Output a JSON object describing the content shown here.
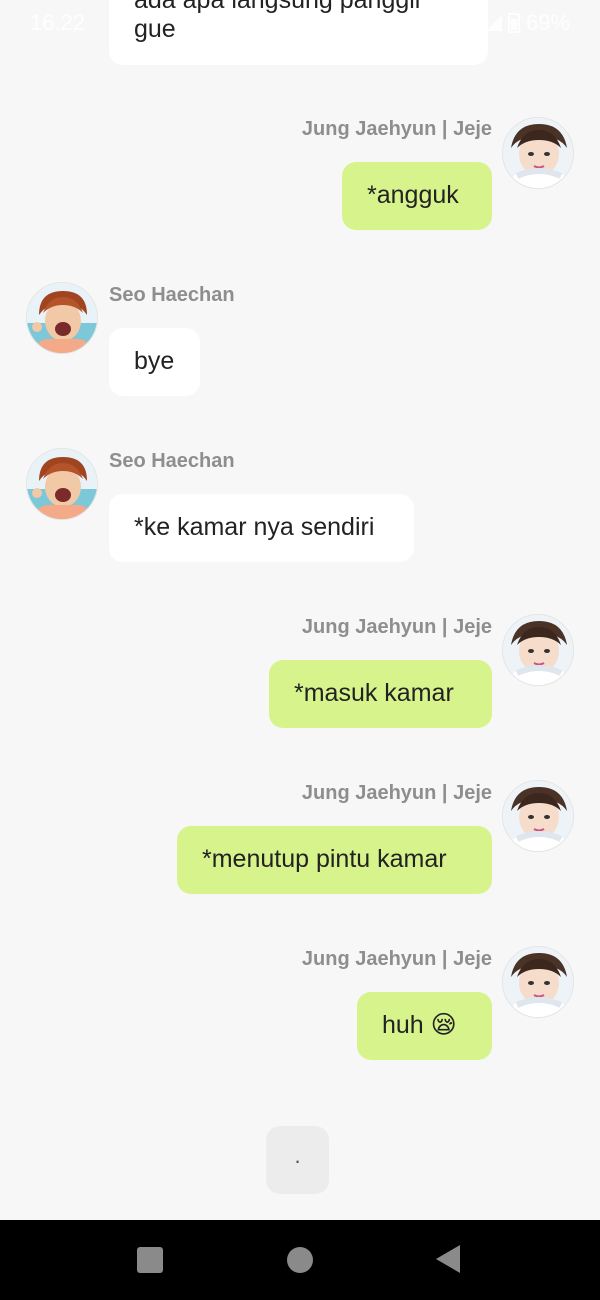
{
  "status_bar": {
    "time": "16.22",
    "battery": "69%"
  },
  "messages": [
    {
      "sender": "",
      "text": "ada apa langsung panggil gue",
      "side": "in"
    },
    {
      "sender": "Jung Jaehyun | Jeje",
      "text": "*angguk",
      "side": "out"
    },
    {
      "sender": "Seo Haechan",
      "text": "bye",
      "side": "in"
    },
    {
      "sender": "Seo Haechan",
      "text": "*ke kamar nya sendiri",
      "side": "in"
    },
    {
      "sender": "Jung Jaehyun | Jeje",
      "text": "*masuk kamar",
      "side": "out"
    },
    {
      "sender": "Jung Jaehyun | Jeje",
      "text": "*menutup pintu kamar",
      "side": "out"
    },
    {
      "sender": "Jung Jaehyun | Jeje",
      "text": "huh 😪",
      "side": "out"
    }
  ],
  "typing_indicator": ".",
  "colors": {
    "background": "#f7f7f7",
    "incoming_bubble": "#ffffff",
    "outgoing_bubble": "#d7f48c",
    "sender_name": "#8e8e8e",
    "nav_bar": "#000000"
  },
  "icons": {
    "nav_recents": "square-icon",
    "nav_home": "circle-icon",
    "nav_back": "triangle-back-icon"
  }
}
